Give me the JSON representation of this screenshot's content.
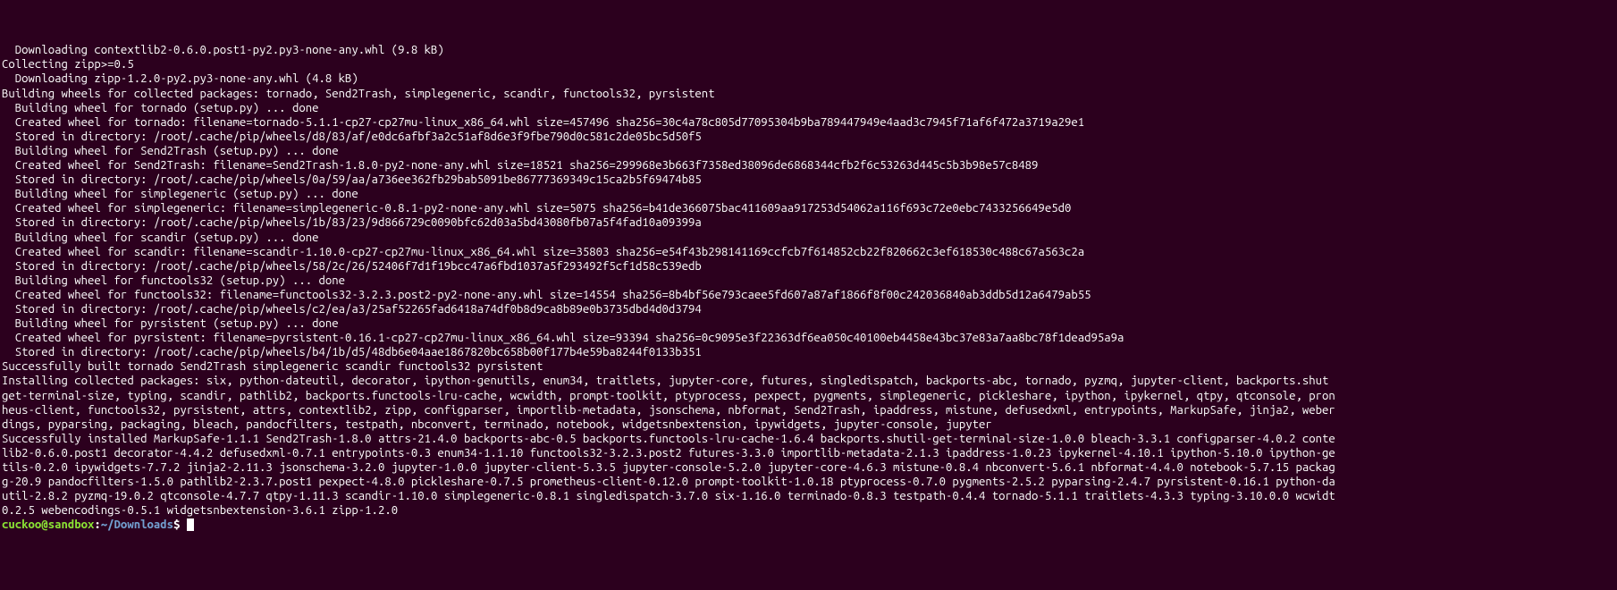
{
  "terminal_lines": [
    "  Downloading contextlib2-0.6.0.post1-py2.py3-none-any.whl (9.8 kB)",
    "Collecting zipp>=0.5",
    "  Downloading zipp-1.2.0-py2.py3-none-any.whl (4.8 kB)",
    "Building wheels for collected packages: tornado, Send2Trash, simplegeneric, scandir, functools32, pyrsistent",
    "  Building wheel for tornado (setup.py) ... done",
    "  Created wheel for tornado: filename=tornado-5.1.1-cp27-cp27mu-linux_x86_64.whl size=457496 sha256=30c4a78c805d77095304b9ba789447949e4aad3c7945f71af6f472a3719a29e1",
    "  Stored in directory: /root/.cache/pip/wheels/d8/83/af/e0dc6afbf3a2c51af8d6e3f9fbe790d0c581c2de05bc5d50f5",
    "  Building wheel for Send2Trash (setup.py) ... done",
    "  Created wheel for Send2Trash: filename=Send2Trash-1.8.0-py2-none-any.whl size=18521 sha256=299968e3b663f7358ed38096de6868344cfb2f6c53263d445c5b3b98e57c8489",
    "  Stored in directory: /root/.cache/pip/wheels/0a/59/aa/a736ee362fb29bab5091be86777369349c15ca2b5f69474b85",
    "  Building wheel for simplegeneric (setup.py) ... done",
    "  Created wheel for simplegeneric: filename=simplegeneric-0.8.1-py2-none-any.whl size=5075 sha256=b41de366075bac411609aa917253d54062a116f693c72e0ebc7433256649e5d0",
    "  Stored in directory: /root/.cache/pip/wheels/1b/83/23/9d866729c0090bfc62d03a5bd43080fb07a5f4fad10a09399a",
    "  Building wheel for scandir (setup.py) ... done",
    "  Created wheel for scandir: filename=scandir-1.10.0-cp27-cp27mu-linux_x86_64.whl size=35803 sha256=e54f43b298141169ccfcb7f614852cb22f820662c3ef618530c488c67a563c2a",
    "  Stored in directory: /root/.cache/pip/wheels/58/2c/26/52406f7d1f19bcc47a6fbd1037a5f293492f5cf1d58c539edb",
    "  Building wheel for functools32 (setup.py) ... done",
    "  Created wheel for functools32: filename=functools32-3.2.3.post2-py2-none-any.whl size=14554 sha256=8b4bf56e793caee5fd607a87af1866f8f00c242036840ab3ddb5d12a6479ab55",
    "  Stored in directory: /root/.cache/pip/wheels/c2/ea/a3/25af52265fad6418a74df0b8d9ca8b89e0b3735dbd4d0d3794",
    "  Building wheel for pyrsistent (setup.py) ... done",
    "  Created wheel for pyrsistent: filename=pyrsistent-0.16.1-cp27-cp27mu-linux_x86_64.whl size=93394 sha256=0c9095e3f22363df6ea050c40100eb4458e43bc37e83a7aa8bc78f1dead95a9a",
    "  Stored in directory: /root/.cache/pip/wheels/b4/1b/d5/48db6e04aae1867820bc658b00f177b4e59ba8244f0133b351",
    "Successfully built tornado Send2Trash simplegeneric scandir functools32 pyrsistent",
    "Installing collected packages: six, python-dateutil, decorator, ipython-genutils, enum34, traitlets, jupyter-core, futures, singledispatch, backports-abc, tornado, pyzmq, jupyter-client, backports.shut",
    "get-terminal-size, typing, scandir, pathlib2, backports.functools-lru-cache, wcwidth, prompt-toolkit, ptyprocess, pexpect, pygments, simplegeneric, pickleshare, ipython, ipykernel, qtpy, qtconsole, pron",
    "heus-client, functools32, pyrsistent, attrs, contextlib2, zipp, configparser, importlib-metadata, jsonschema, nbformat, Send2Trash, ipaddress, mistune, defusedxml, entrypoints, MarkupSafe, jinja2, weber",
    "dings, pyparsing, packaging, bleach, pandocfilters, testpath, nbconvert, terminado, notebook, widgetsnbextension, ipywidgets, jupyter-console, jupyter",
    "Successfully installed MarkupSafe-1.1.1 Send2Trash-1.8.0 attrs-21.4.0 backports-abc-0.5 backports.functools-lru-cache-1.6.4 backports.shutil-get-terminal-size-1.0.0 bleach-3.3.1 configparser-4.0.2 conte",
    "lib2-0.6.0.post1 decorator-4.4.2 defusedxml-0.7.1 entrypoints-0.3 enum34-1.1.10 functools32-3.2.3.post2 futures-3.3.0 importlib-metadata-2.1.3 ipaddress-1.0.23 ipykernel-4.10.1 ipython-5.10.0 ipython-ge",
    "tils-0.2.0 ipywidgets-7.7.2 jinja2-2.11.3 jsonschema-3.2.0 jupyter-1.0.0 jupyter-client-5.3.5 jupyter-console-5.2.0 jupyter-core-4.6.3 mistune-0.8.4 nbconvert-5.6.1 nbformat-4.4.0 notebook-5.7.15 packag",
    "g-20.9 pandocfilters-1.5.0 pathlib2-2.3.7.post1 pexpect-4.8.0 pickleshare-0.7.5 prometheus-client-0.12.0 prompt-toolkit-1.0.18 ptyprocess-0.7.0 pygments-2.5.2 pyparsing-2.4.7 pyrsistent-0.16.1 python-da",
    "util-2.8.2 pyzmq-19.0.2 qtconsole-4.7.7 qtpy-1.11.3 scandir-1.10.0 simplegeneric-0.8.1 singledispatch-3.7.0 six-1.16.0 terminado-0.8.3 testpath-0.4.4 tornado-5.1.1 traitlets-4.3.3 typing-3.10.0.0 wcwidt",
    "0.2.5 webencodings-0.5.1 widgetsnbextension-3.6.1 zipp-1.2.0"
  ],
  "prompt": {
    "user_host": "cuckoo@sandbox",
    "separator": ":",
    "path": "~/Downloads",
    "symbol": "$"
  }
}
